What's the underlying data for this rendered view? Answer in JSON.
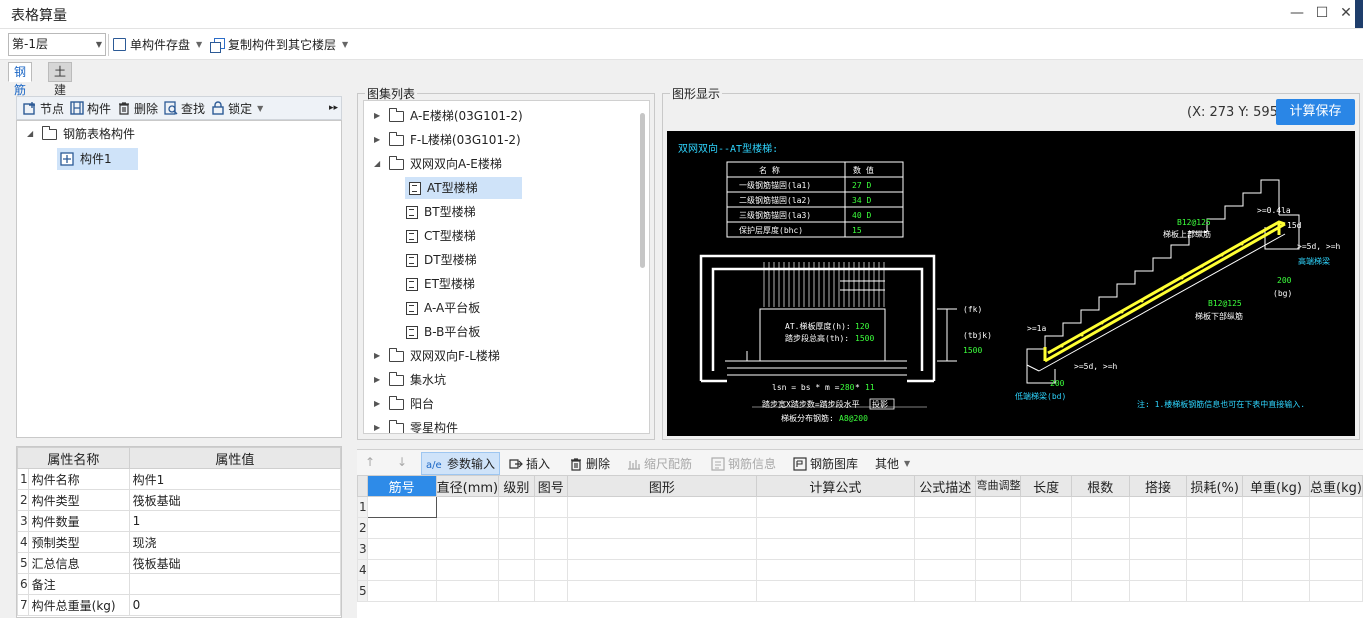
{
  "window": {
    "title": "表格算量",
    "min_glyph": "—",
    "max_glyph": "☐",
    "close_glyph": "✕"
  },
  "toolbar": {
    "floor_value": "第-1层",
    "save_single_label": "单构件存盘",
    "copy_label": "复制构件到其它楼层"
  },
  "tabs": [
    {
      "label": "钢筋",
      "active": true
    },
    {
      "label": "土建",
      "active": false
    }
  ],
  "left_tools": {
    "node": "节点",
    "component": "构件",
    "delete": "删除",
    "find": "查找",
    "lock": "锁定",
    "more": "▸▸"
  },
  "tree": {
    "root": "钢筋表格构件",
    "child": "构件1"
  },
  "props": {
    "col_name": "属性名称",
    "col_value": "属性值",
    "rows": [
      {
        "idx": "1",
        "name": "构件名称",
        "value": "构件1"
      },
      {
        "idx": "2",
        "name": "构件类型",
        "value": "筏板基础"
      },
      {
        "idx": "3",
        "name": "构件数量",
        "value": "1"
      },
      {
        "idx": "4",
        "name": "预制类型",
        "value": "现浇"
      },
      {
        "idx": "5",
        "name": "汇总信息",
        "value": "筏板基础"
      },
      {
        "idx": "6",
        "name": "备注",
        "value": ""
      },
      {
        "idx": "7",
        "name": "构件总重量(kg)",
        "value": "0"
      }
    ]
  },
  "atlas": {
    "title": "图集列表",
    "items": [
      {
        "label": "A-E楼梯(03G101-2)",
        "type": "folder",
        "expanded": false
      },
      {
        "label": "F-L楼梯(03G101-2)",
        "type": "folder",
        "expanded": false
      },
      {
        "label": "双网双向A-E楼梯",
        "type": "folder",
        "expanded": true
      },
      {
        "label": "AT型楼梯",
        "type": "doc",
        "selected": true
      },
      {
        "label": "BT型楼梯",
        "type": "doc"
      },
      {
        "label": "CT型楼梯",
        "type": "doc"
      },
      {
        "label": "DT型楼梯",
        "type": "doc"
      },
      {
        "label": "ET型楼梯",
        "type": "doc"
      },
      {
        "label": "A-A平台板",
        "type": "doc"
      },
      {
        "label": "B-B平台板",
        "type": "doc"
      },
      {
        "label": "双网双向F-L楼梯",
        "type": "folder",
        "expanded": false
      },
      {
        "label": "集水坑",
        "type": "folder",
        "expanded": false
      },
      {
        "label": "阳台",
        "type": "folder",
        "expanded": false
      },
      {
        "label": "零星构件",
        "type": "folder",
        "expanded": false
      }
    ]
  },
  "graph": {
    "title": "图形显示",
    "coord": "(X: 273 Y: 595)",
    "calc_save": "计算保存",
    "drawing": {
      "heading": "双网双向--AT型楼梯:",
      "table_head": [
        "名    称",
        "数    值"
      ],
      "table_rows": [
        [
          "一级钢筋锚固(la1)",
          "27 D"
        ],
        [
          "二级钢筋锚固(la2)",
          "34 D"
        ],
        [
          "三级钢筋锚固(la3)",
          "40 D"
        ],
        [
          "保护层厚度(bhc)",
          "15"
        ]
      ],
      "thickness_label": "AT.梯板厚度(h):",
      "thickness_value": "120",
      "height_label": "踏步段总高(th):",
      "height_value": "1500",
      "formula": "lsn = bs * m =",
      "formula_b": "280",
      "formula_m": "11",
      "width_note": "踏步宽X踏步数=踏步段水平",
      "width_note_tail": "投影",
      "dist_label": "梯板分布钢筋:",
      "dist_value": "A8@200",
      "fk": "(fk)",
      "tbjk": "(tbjk)",
      "h1500": "1500",
      "top_bar": "B12@125",
      "top_bar_note": "梯板上部纵筋",
      "bot_bar": "B12@125",
      "bot_bar_note": "梯板下部纵筋",
      "high_beam": "高端梯梁",
      "low_beam": "低端梯梁(bd)",
      "la_left": ">=1a",
      "w200a": "200",
      "bg": "(bg)",
      "w200b": "200",
      "ge_5d_top": ">=5d, >=h",
      "ge_5d_bot": ">=5d, >=h",
      "ge_04": ">=0.4la",
      "la_top": "15d",
      "note": "注: 1.楼梯板钢筋信息也可在下表中直接输入."
    }
  },
  "bottom_toolbar": {
    "up": "↑",
    "down": "↓",
    "param_input": "参数输入",
    "insert": "插入",
    "delete": "删除",
    "scale_rebar": "缩尺配筋",
    "rebar_info": "钢筋信息",
    "rebar_lib": "钢筋图库",
    "other": "其他"
  },
  "grid": {
    "headers": [
      "筋号",
      "直径(mm)",
      "级别",
      "图号",
      "图形",
      "计算公式",
      "公式描述",
      "弯曲调整",
      "长度",
      "根数",
      "搭接",
      "损耗(%)",
      "单重(kg)",
      "总重(kg)"
    ],
    "row_numbers": [
      "1",
      "2",
      "3",
      "4",
      "5"
    ]
  }
}
